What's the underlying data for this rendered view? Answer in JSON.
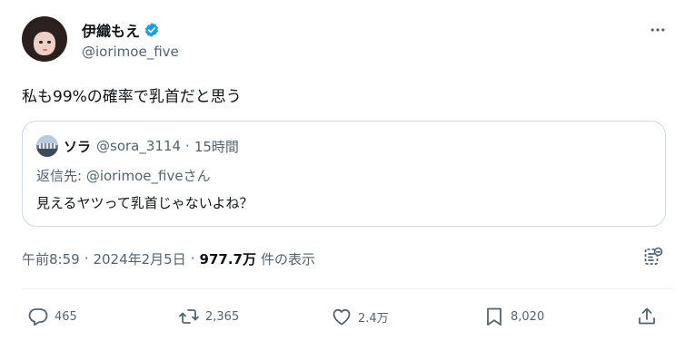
{
  "author": {
    "display_name": "伊織もえ",
    "handle": "@iorimoe_five",
    "verified": true
  },
  "tweet": {
    "text": "私も99%の確率で乳首だと思う"
  },
  "quote": {
    "name": "ソラ",
    "handle": "@sora_3114",
    "separator": "·",
    "time": "15時間",
    "reply_prefix": "返信先: ",
    "reply_handle": "@iorimoe_five",
    "reply_suffix": "さん",
    "text": "見えるヤツって乳首じゃないよね？"
  },
  "meta": {
    "time": "午前8:59",
    "sep1": "·",
    "date": "2024年2月5日",
    "sep2": "·",
    "views": "977.7万",
    "views_label": "件の表示"
  },
  "actions": {
    "replies": "465",
    "retweets": "2,365",
    "likes": "2.4万",
    "bookmarks": "8,020"
  },
  "colors": {
    "accent": "#1d9bf0",
    "text": "#0f1419",
    "muted": "#536471",
    "border": "#cfd9de"
  },
  "icons": [
    "more-icon",
    "verified-badge-icon",
    "grok-icon",
    "reply-icon",
    "retweet-icon",
    "like-icon",
    "bookmark-icon",
    "share-icon"
  ]
}
